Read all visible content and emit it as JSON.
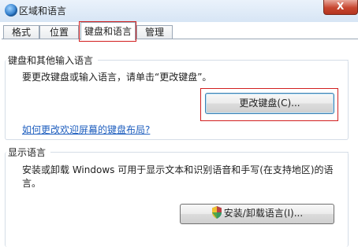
{
  "window": {
    "title": "区域和语言",
    "close_glyph": "X"
  },
  "tabs": [
    {
      "label": "格式"
    },
    {
      "label": "位置"
    },
    {
      "label": "键盘和语言"
    },
    {
      "label": "管理"
    }
  ],
  "keyboard_group": {
    "title": "键盘和其他输入语言",
    "description": "要更改键盘或输入语言，请单击“更改键盘”。",
    "button_label": "更改键盘(C)...",
    "help_link": "如何更改欢迎屏幕的键盘布局?"
  },
  "display_group": {
    "title": "显示语言",
    "description": "安装或卸载 Windows 可用于显示文本和识别语音和手写(在支持地区)的语言。",
    "button_label": "安装/卸载语言(I)..."
  },
  "colors": {
    "accent_red": "#d21f1f",
    "link_blue": "#1f5fbf"
  }
}
